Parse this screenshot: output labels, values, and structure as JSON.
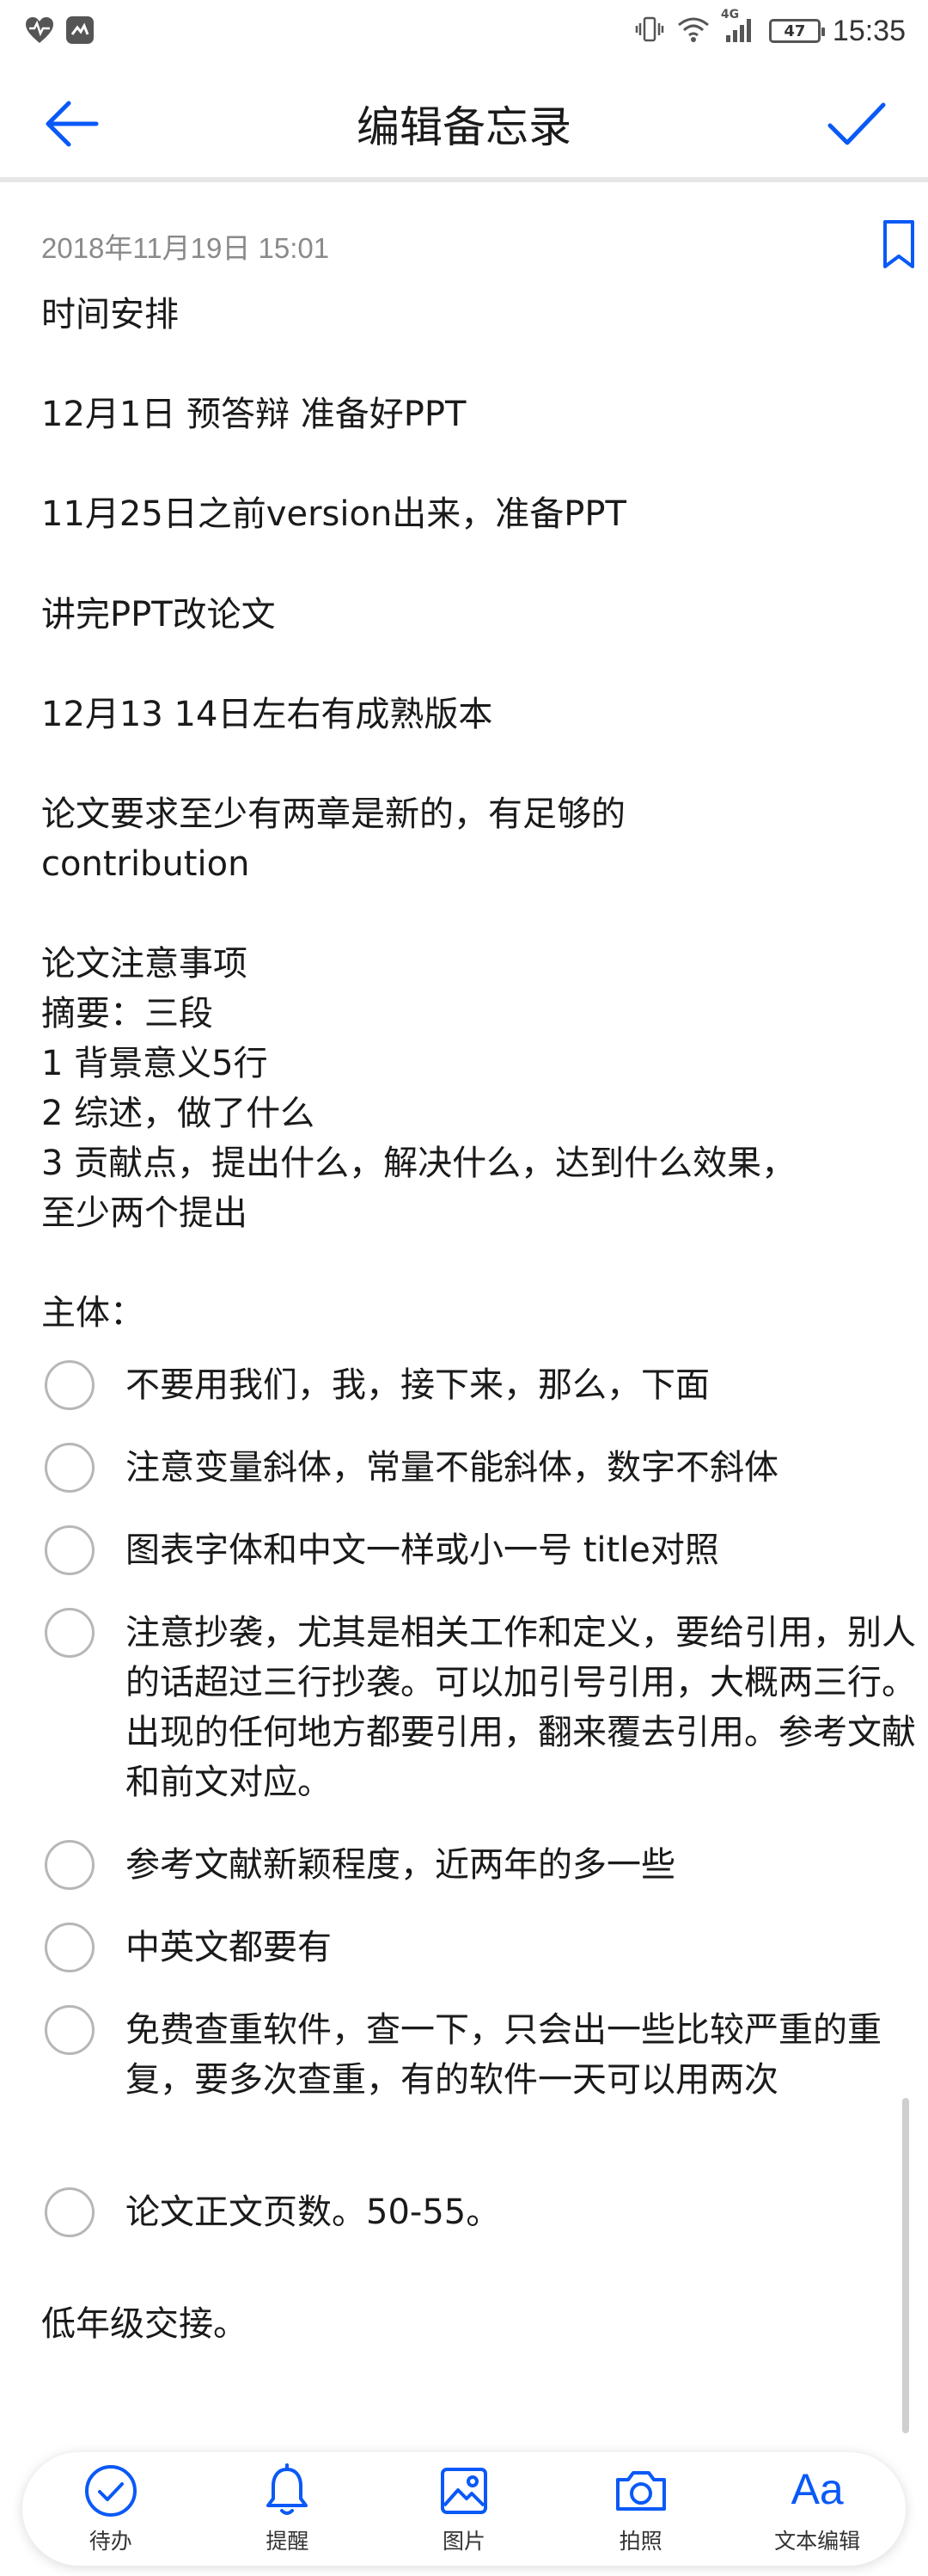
{
  "status_bar": {
    "time": "15:35",
    "battery": "47",
    "network": "4G",
    "icons": [
      "health-icon",
      "app-notification-icon",
      "vibrate-icon",
      "wifi-icon",
      "signal-icon",
      "battery-icon"
    ]
  },
  "header": {
    "title": "编辑备忘录",
    "back_icon": "arrow-left-icon",
    "confirm_icon": "checkmark-icon"
  },
  "note": {
    "date": "2018年11月19日 15:01",
    "lines": [
      "时间安排",
      "12月1日  预答辩  准备好PPT",
      "11月25日之前version出来，准备PPT",
      "讲完PPT改论文",
      "12月13 14日左右有成熟版本",
      "论文要求至少有两章是新的，有足够的",
      "contribution",
      "论文注意事项",
      "摘要：三段",
      "1 背景意义5行",
      "2 综述，做了什么",
      "3 贡献点，提出什么，解决什么，达到什么效果，",
      "至少两个提出",
      "主体："
    ],
    "checklist": [
      {
        "text": "不要用我们，我，接下来，那么，下面",
        "checked": false
      },
      {
        "text": "注意变量斜体，常量不能斜体，数字不斜体",
        "checked": false
      },
      {
        "text": "图表字体和中文一样或小一号  title对照",
        "checked": false
      },
      {
        "text": "注意抄袭，尤其是相关工作和定义，要给引用，别人的话超过三行抄袭。可以加引号引用，大概两三行。出现的任何地方都要引用，翻来覆去引用。参考文献和前文对应。",
        "checked": false
      },
      {
        "text": "参考文献新颖程度，近两年的多一些",
        "checked": false
      },
      {
        "text": "中英文都要有",
        "checked": false
      },
      {
        "text": "免费查重软件，查一下，只会出一些比较严重的重复，要多次查重，有的软件一天可以用两次",
        "checked": false
      },
      {
        "text": "论文正文页数。50-55。",
        "checked": false
      }
    ],
    "footer_line": "低年级交接。"
  },
  "toolbar": {
    "accent": "#0a59f7",
    "items": [
      {
        "label": "待办",
        "icon": "checklist-icon"
      },
      {
        "label": "提醒",
        "icon": "bell-icon"
      },
      {
        "label": "图片",
        "icon": "image-icon"
      },
      {
        "label": "拍照",
        "icon": "camera-icon"
      },
      {
        "label": "文本编辑",
        "icon": "text-format-icon",
        "glyph": "Aa"
      }
    ]
  }
}
